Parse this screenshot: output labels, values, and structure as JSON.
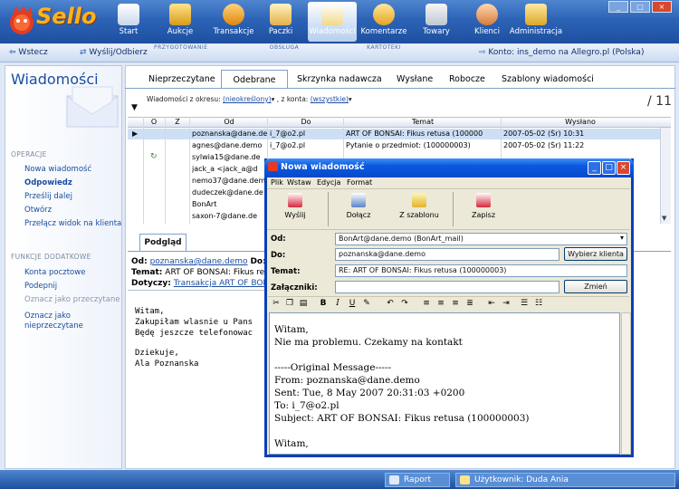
{
  "app": {
    "logo": "Sello"
  },
  "nav": [
    {
      "label": "Start",
      "icon": "home-icon"
    },
    {
      "label": "Aukcje",
      "icon": "gavel-icon"
    },
    {
      "label": "Transakcje",
      "icon": "transactions-icon"
    },
    {
      "label": "Paczki",
      "icon": "package-icon"
    },
    {
      "label": "Wiadomości",
      "icon": "mail-icon"
    },
    {
      "label": "Komentarze",
      "icon": "comments-icon"
    },
    {
      "label": "Towary",
      "icon": "goods-icon"
    },
    {
      "label": "Klienci",
      "icon": "clients-icon"
    },
    {
      "label": "Administracja",
      "icon": "admin-icon"
    }
  ],
  "groups": {
    "przygotowanie": "PRZYGOTOWANIE",
    "obsluga": "OBSŁUGA",
    "kartoteki": "KARTOTEKI"
  },
  "subbar": {
    "back": "Wstecz",
    "sendreceive": "Wyślij/Odbierz",
    "account": "Konto: ins_demo na Allegro.pl (Polska)"
  },
  "left": {
    "title": "Wiadomości",
    "ops_title": "OPERACJE",
    "ops": [
      {
        "label": "Nowa wiadomość",
        "style": "normal"
      },
      {
        "label": "Odpowiedz",
        "style": "bold"
      },
      {
        "label": "Prześlij dalej",
        "style": "normal"
      },
      {
        "label": "Otwórz",
        "style": "normal"
      },
      {
        "label": "Przełącz widok na klienta",
        "style": "normal"
      }
    ],
    "extra_title": "FUNKCJE DODATKOWE",
    "extra": [
      {
        "label": "Konta pocztowe",
        "style": "normal"
      },
      {
        "label": "Podepnij",
        "style": "normal"
      },
      {
        "label": "Oznacz jako przeczytane",
        "style": "disabled"
      },
      {
        "label": "Oznacz jako",
        "style": "normal"
      },
      {
        "label": "nieprzeczytane",
        "style": "normal"
      }
    ]
  },
  "tabs": [
    "Nieprzeczytane",
    "Odebrane",
    "Skrzynka nadawcza",
    "Wysłane",
    "Robocze",
    "Szablony wiadomości"
  ],
  "filter": {
    "period_label": "Wiadomości z okresu:",
    "period_value": "(nieokreślony)",
    "account_label": ", z konta:",
    "account_value": "(wszystkie)",
    "count": "/ 11"
  },
  "table": {
    "headers": [
      "O",
      "Z",
      "Od",
      "Do",
      "Temat",
      "Wysłano"
    ],
    "rows": [
      {
        "od": "poznanska@dane.demo",
        "do": "i_7@o2.pl",
        "temat": "ART OF BONSAI: Fikus retusa (100000",
        "wyslano": "2007-05-02 (Śr) 10:31"
      },
      {
        "od": "agnes@dane.demo",
        "do": "i_7@o2.pl",
        "temat": "Pytanie o przedmiot: (100000003)",
        "wyslano": "2007-05-02 (Śr) 11:22"
      },
      {
        "od": "sylwia15@dane.de",
        "do": "",
        "temat": "",
        "wyslano": ""
      },
      {
        "od": "jack_a <jack_a@d",
        "do": "",
        "temat": "",
        "wyslano": ""
      },
      {
        "od": "nemo37@dane.dem",
        "do": "",
        "temat": "",
        "wyslano": ""
      },
      {
        "od": "dudeczek@dane.de",
        "do": "",
        "temat": "",
        "wyslano": ""
      },
      {
        "od": "BonArt",
        "do": "",
        "temat": "",
        "wyslano": ""
      },
      {
        "od": "saxon-7@dane.de",
        "do": "",
        "temat": "",
        "wyslano": ""
      }
    ]
  },
  "preview": {
    "tab": "Podgląd",
    "od_label": "Od:",
    "od_value": "poznanska@dane.demo",
    "do_label": "Do:",
    "do_value": "i",
    "temat_label": "Temat:",
    "temat_value": "ART OF BONSAI: Fikus retu",
    "dotyczy_label": "Dotyczy:",
    "dotyczy_value": "Transakcja ART OF BON",
    "body": [
      "Witam,",
      "Zakupiłam wlasnie u Pans",
      "Będę jeszcze telefonowac",
      "",
      "Dziekuje,",
      "Ala Poznanska"
    ]
  },
  "bottom": {
    "report": "Raport",
    "user": "Użytkownik: Duda Ania"
  },
  "modal": {
    "title": "Nowa wiadomość",
    "menu": [
      "Plik",
      "Wstaw",
      "Edycja",
      "Format"
    ],
    "toolbar": [
      {
        "label": "Wyślij",
        "icon": "send-icon"
      },
      {
        "label": "Dołącz",
        "icon": "attach-icon"
      },
      {
        "label": "Z szablonu",
        "icon": "template-icon"
      },
      {
        "label": "Zapisz",
        "icon": "save-icon"
      }
    ],
    "od_label": "Od:",
    "od_value": "BonArt@dane.demo (BonArt_mail)",
    "do_label": "Do:",
    "do_value": "poznanska@dane.demo",
    "choose_client": "Wybierz klienta",
    "temat_label": "Temat:",
    "temat_value": "RE: ART OF BONSAI: Fikus retusa (100000003)",
    "zal_label": "Załączniki:",
    "zal_value": "",
    "change": "Zmień",
    "editor_lines": [
      "Witam,",
      "Nie ma problemu. Czekamy na kontakt",
      "",
      "-----Original Message-----",
      "From: poznanska@dane.demo",
      "Sent: Tue, 8 May 2007 20:31:03 +0200",
      "To: i_7@o2.pl",
      "Subject: ART OF BONSAI: Fikus retusa (100000003)",
      "",
      "Witam,"
    ]
  },
  "colors": {
    "accent": "#1b4da0",
    "ribbon": "#2d63b6",
    "selected_row": "#cddff5",
    "modal_title": "#0a58e0"
  }
}
